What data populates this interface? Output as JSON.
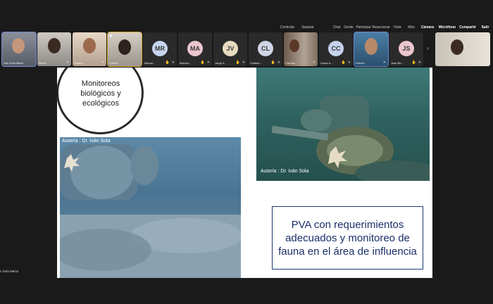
{
  "toolbar": {
    "items": [
      "Controlar",
      "Separar",
      "Chat",
      "Gente",
      "Participar",
      "Reaccionar",
      "Vista",
      "Más",
      "Cámara",
      "Micrófono",
      "Compartir",
      "Salir"
    ]
  },
  "participants": [
    {
      "name": "Iván Sola Macia",
      "initials": ""
    },
    {
      "name": "María ...",
      "initials": ""
    },
    {
      "name": "Solang...",
      "initials": ""
    },
    {
      "name": "Camila ...",
      "initials": ""
    },
    {
      "name": "Marcel...",
      "initials": "MR"
    },
    {
      "name": "Marisol...",
      "initials": "MA"
    },
    {
      "name": "Jorge A...",
      "initials": "JV"
    },
    {
      "name": "Cristian...",
      "initials": "CL"
    },
    {
      "name": "Carmen...",
      "initials": ""
    },
    {
      "name": "Cesar A...",
      "initials": "CC"
    },
    {
      "name": "Robert...",
      "initials": ""
    },
    {
      "name": "Jose Be...",
      "initials": "JS"
    }
  ],
  "self_view": {
    "name": "..."
  },
  "strip_more_icon": "chevron-right-icon",
  "slide": {
    "circle_text": "Monitoreos biológicos y ecológicos",
    "photo_top_credit": "Autoría : Dr. Iván Sola",
    "photo_bottom_credit": "Autoría : Dr. Iván Sola",
    "pva_text": "PVA con requerimientos adecuados y monitoreo de fauna en el área de influencia"
  },
  "bottom_label": "n Sola Macia",
  "colors": {
    "accent": "#6f8ad8",
    "speaking": "#d5a928",
    "slide_text": "#1b2f6a"
  }
}
